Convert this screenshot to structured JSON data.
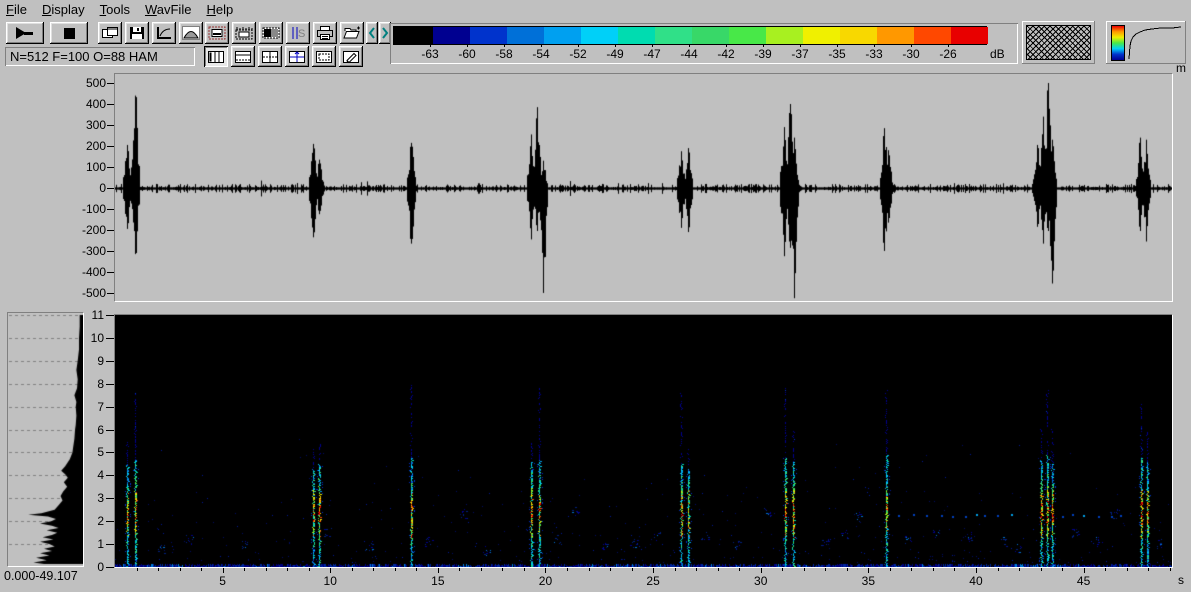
{
  "menubar": {
    "items": [
      {
        "label": "File",
        "accel_index": 0
      },
      {
        "label": "Display",
        "accel_index": 0
      },
      {
        "label": "Tools",
        "accel_index": 0
      },
      {
        "label": "WavFile",
        "accel_index": 0
      },
      {
        "label": "Help",
        "accel_index": 0
      }
    ]
  },
  "toolbar": {
    "status_text": "N=512 F=100 O=88 HAM",
    "row1": [
      {
        "name": "play"
      },
      {
        "name": "stop"
      },
      {
        "name": "cascade-windows"
      },
      {
        "name": "save"
      },
      {
        "name": "transfer-curve"
      },
      {
        "name": "window-function"
      },
      {
        "name": "annotate-display"
      },
      {
        "name": "time-scale"
      },
      {
        "name": "shade-region"
      },
      {
        "name": "signal-settings"
      },
      {
        "name": "print"
      },
      {
        "name": "open-file"
      },
      {
        "name": "prev",
        "glyph": "<"
      },
      {
        "name": "next",
        "glyph": ">"
      }
    ],
    "row2": [
      {
        "name": "layout-vertical-panes",
        "pressed": true
      },
      {
        "name": "layout-horizontal-split",
        "pressed": false
      },
      {
        "name": "layout-quad",
        "pressed": false
      },
      {
        "name": "layout-quad-arrows",
        "pressed": false
      },
      {
        "name": "layout-single-pane",
        "pressed": false
      },
      {
        "name": "edit-annotations",
        "pressed": false
      }
    ]
  },
  "colorbar": {
    "colors": [
      "#000000",
      "#000090",
      "#0033cc",
      "#0070d8",
      "#00a0f0",
      "#00d0f8",
      "#00dcb0",
      "#30e088",
      "#38d868",
      "#48e848",
      "#a8f020",
      "#f0f000",
      "#f8d800",
      "#ff9800",
      "#ff4800",
      "#e80000"
    ],
    "tick_labels": [
      "-63",
      "-60",
      "-58",
      "-54",
      "-52",
      "-49",
      "-47",
      "-44",
      "-42",
      "-39",
      "-37",
      "-35",
      "-33",
      "-30",
      "-26"
    ],
    "unit": "dB"
  },
  "footer": {
    "range_text": "0.000-49.107"
  },
  "colors": {
    "window_bg": "#c0c0c0",
    "spectrogram_bg": "#000000",
    "ink": "#000000"
  },
  "chart_data": [
    {
      "type": "line",
      "title": "waveform-oscillogram",
      "y_unit": "m",
      "xlim": [
        0,
        49.107
      ],
      "ylim": [
        -500,
        500
      ],
      "yticks": [
        500,
        400,
        300,
        200,
        100,
        0,
        -100,
        -200,
        -300,
        -400,
        -500
      ],
      "baseline_noise_amplitude": 10,
      "clicks": [
        {
          "t": 0.55,
          "peak": 205,
          "trough": -190
        },
        {
          "t": 0.95,
          "peak": 440,
          "trough": -310
        },
        {
          "t": 9.2,
          "peak": 210,
          "trough": -230
        },
        {
          "t": 9.5,
          "peak": 135,
          "trough": -120
        },
        {
          "t": 13.75,
          "peak": 215,
          "trough": -260
        },
        {
          "t": 19.35,
          "peak": 255,
          "trough": -240
        },
        {
          "t": 19.6,
          "peak": 385,
          "trough": -200
        },
        {
          "t": 19.9,
          "peak": 130,
          "trough": -495
        },
        {
          "t": 26.3,
          "peak": 175,
          "trough": -185
        },
        {
          "t": 26.6,
          "peak": 190,
          "trough": -205
        },
        {
          "t": 31.1,
          "peak": 290,
          "trough": -320
        },
        {
          "t": 31.35,
          "peak": 400,
          "trough": -280
        },
        {
          "t": 31.55,
          "peak": 240,
          "trough": -520
        },
        {
          "t": 35.75,
          "peak": 285,
          "trough": -295
        },
        {
          "t": 35.9,
          "peak": 180,
          "trough": -160
        },
        {
          "t": 42.85,
          "peak": 205,
          "trough": -180
        },
        {
          "t": 43.1,
          "peak": 340,
          "trough": -260
        },
        {
          "t": 43.35,
          "peak": 500,
          "trough": -200
        },
        {
          "t": 43.55,
          "peak": 230,
          "trough": -450
        },
        {
          "t": 47.6,
          "peak": 240,
          "trough": -200
        },
        {
          "t": 47.9,
          "peak": 230,
          "trough": -250
        }
      ]
    },
    {
      "type": "heatmap",
      "title": "spectrogram",
      "x_unit": "s",
      "xlim": [
        0,
        49.107
      ],
      "ylim": [
        0,
        11
      ],
      "xticks": [
        5,
        10,
        15,
        20,
        25,
        30,
        35,
        40,
        45
      ],
      "x_tick_step_minor": 1,
      "yticks": [
        0,
        1,
        2,
        3,
        4,
        5,
        6,
        7,
        8,
        9,
        10,
        11
      ],
      "db_scale": [
        -63,
        -60,
        -58,
        -54,
        -52,
        -49,
        -47,
        -44,
        -42,
        -39,
        -37,
        -35,
        -33,
        -30,
        -26
      ],
      "clicks": [
        {
          "t": 0.55,
          "f_strong": 4.5,
          "f_faint": 5.5,
          "heat": 0.9
        },
        {
          "t": 0.95,
          "f_strong": 4.7,
          "f_faint": 7.6,
          "heat": 1.0
        },
        {
          "t": 9.2,
          "f_strong": 4.3,
          "f_faint": 5.2,
          "heat": 0.9
        },
        {
          "t": 9.5,
          "f_strong": 4.5,
          "f_faint": 5.4,
          "heat": 1.0
        },
        {
          "t": 13.75,
          "f_strong": 4.8,
          "f_faint": 8.0,
          "heat": 0.9
        },
        {
          "t": 19.35,
          "f_strong": 4.6,
          "f_faint": 5.4,
          "heat": 1.0
        },
        {
          "t": 19.7,
          "f_strong": 4.7,
          "f_faint": 7.8,
          "heat": 0.9
        },
        {
          "t": 26.3,
          "f_strong": 4.5,
          "f_faint": 7.6,
          "heat": 0.9
        },
        {
          "t": 26.6,
          "f_strong": 4.3,
          "f_faint": 5.2,
          "heat": 0.8
        },
        {
          "t": 31.15,
          "f_strong": 4.8,
          "f_faint": 7.9,
          "heat": 1.0
        },
        {
          "t": 31.5,
          "f_strong": 4.6,
          "f_faint": 6.0,
          "heat": 1.0
        },
        {
          "t": 35.8,
          "f_strong": 4.9,
          "f_faint": 7.7,
          "heat": 0.9
        },
        {
          "t": 43.0,
          "f_strong": 4.7,
          "f_faint": 6.0,
          "heat": 1.0
        },
        {
          "t": 43.3,
          "f_strong": 4.9,
          "f_faint": 7.7,
          "heat": 1.0
        },
        {
          "t": 43.55,
          "f_strong": 4.5,
          "f_faint": 6.0,
          "heat": 0.9
        },
        {
          "t": 47.65,
          "f_strong": 4.8,
          "f_faint": 7.5,
          "heat": 1.0
        },
        {
          "t": 47.95,
          "f_strong": 4.6,
          "f_faint": 6.0,
          "heat": 0.9
        }
      ],
      "dotted_tracks": [
        {
          "t0": 36.4,
          "t1": 41.8,
          "f": 2.25
        },
        {
          "t0": 44.0,
          "t1": 46.9,
          "f": 2.25
        }
      ],
      "blobs": [
        [
          2.2,
          0.8
        ],
        [
          3.5,
          1.2
        ],
        [
          6.1,
          1.0
        ],
        [
          9.9,
          1.5
        ],
        [
          11.8,
          0.9
        ],
        [
          14.6,
          1.1
        ],
        [
          16.2,
          2.3
        ],
        [
          17.3,
          0.7
        ],
        [
          20.6,
          1.2
        ],
        [
          21.4,
          2.4
        ],
        [
          22.7,
          0.9
        ],
        [
          24.1,
          1.0
        ],
        [
          25.2,
          1.3
        ],
        [
          27.4,
          1.3
        ],
        [
          28.9,
          0.9
        ],
        [
          30.3,
          2.4
        ],
        [
          33.0,
          1.1
        ],
        [
          33.9,
          1.4
        ],
        [
          34.6,
          2.2
        ],
        [
          36.9,
          1.2
        ],
        [
          38.2,
          1.5
        ],
        [
          39.7,
          1.3
        ],
        [
          41.3,
          1.1
        ],
        [
          42.0,
          0.8
        ],
        [
          44.6,
          1.5
        ],
        [
          45.7,
          1.1
        ],
        [
          46.4,
          2.3
        ],
        [
          48.6,
          1.0
        ]
      ]
    },
    {
      "type": "area",
      "title": "average-spectrum-panel",
      "flim": [
        0,
        11
      ],
      "points": [
        [
          11,
          0.02
        ],
        [
          10.5,
          0.02
        ],
        [
          10,
          0.03
        ],
        [
          9.5,
          0.03
        ],
        [
          9,
          0.05
        ],
        [
          8.6,
          0.07
        ],
        [
          8.2,
          0.05
        ],
        [
          7.8,
          0.06
        ],
        [
          7.5,
          0.1
        ],
        [
          7.2,
          0.07
        ],
        [
          7,
          0.08
        ],
        [
          6.6,
          0.07
        ],
        [
          6.2,
          0.08
        ],
        [
          6,
          0.09
        ],
        [
          5.6,
          0.1
        ],
        [
          5.2,
          0.12
        ],
        [
          5,
          0.13
        ],
        [
          4.7,
          0.17
        ],
        [
          4.4,
          0.24
        ],
        [
          4.2,
          0.3
        ],
        [
          4.05,
          0.24
        ],
        [
          3.9,
          0.2
        ],
        [
          3.7,
          0.26
        ],
        [
          3.5,
          0.21
        ],
        [
          3.3,
          0.27
        ],
        [
          3.1,
          0.31
        ],
        [
          2.9,
          0.28
        ],
        [
          2.7,
          0.34
        ],
        [
          2.5,
          0.4
        ],
        [
          2.35,
          0.6
        ],
        [
          2.28,
          0.8
        ],
        [
          2.2,
          0.5
        ],
        [
          2.1,
          0.38
        ],
        [
          2,
          0.45
        ],
        [
          1.9,
          0.62
        ],
        [
          1.8,
          0.44
        ],
        [
          1.7,
          0.34
        ],
        [
          1.6,
          0.52
        ],
        [
          1.5,
          0.36
        ],
        [
          1.4,
          0.44
        ],
        [
          1.3,
          0.58
        ],
        [
          1.2,
          0.42
        ],
        [
          1.1,
          0.62
        ],
        [
          1,
          0.48
        ],
        [
          0.9,
          0.4
        ],
        [
          0.8,
          0.56
        ],
        [
          0.7,
          0.44
        ],
        [
          0.6,
          0.62
        ],
        [
          0.5,
          0.48
        ],
        [
          0.4,
          0.68
        ],
        [
          0.3,
          0.52
        ],
        [
          0.2,
          0.72
        ],
        [
          0.1,
          0.56
        ],
        [
          0.05,
          0.8
        ],
        [
          0,
          0.6
        ]
      ]
    }
  ]
}
